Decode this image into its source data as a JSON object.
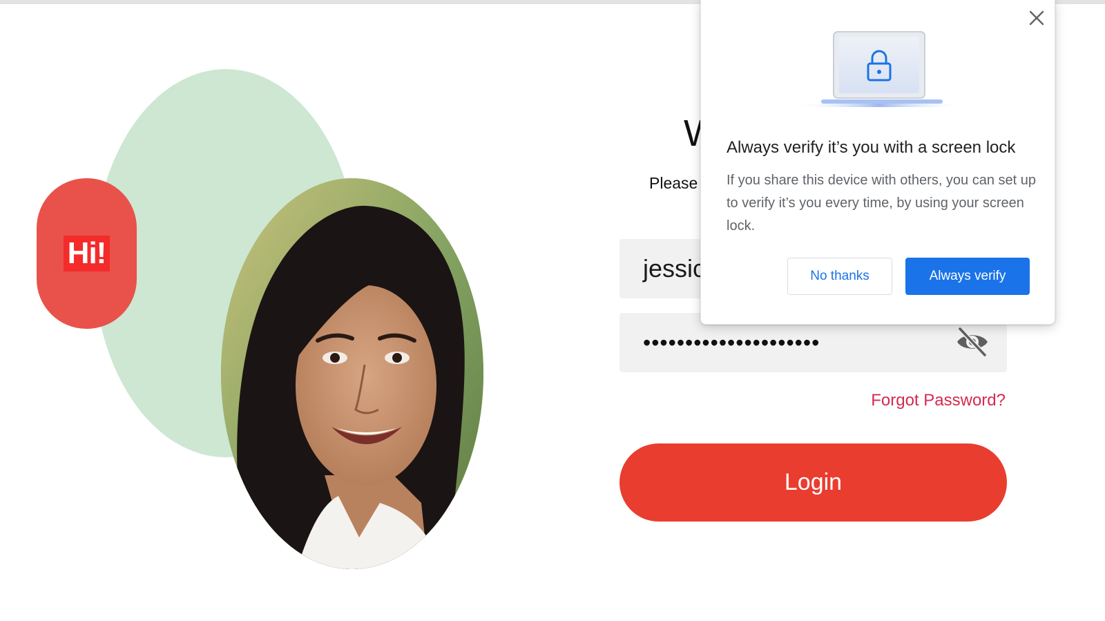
{
  "illustration": {
    "greeting_badge": "Hi!",
    "colors": {
      "green_blob": "#cde7d2",
      "hi_pill": "#e9524a",
      "hi_badge": "#f42b2b"
    }
  },
  "login_form": {
    "title_visible": "W",
    "subtitle_visible": "Please",
    "username_value_visible": "jessic",
    "password_masked": "•••••••••••••••••••••",
    "password_toggle_icon": "eye-slash-icon",
    "forgot_password_label": "Forgot Password?",
    "login_label": "Login",
    "colors": {
      "login_button": "#e93d2f",
      "forgot_link": "#d42a4f",
      "field_bg": "#f1f1f1"
    }
  },
  "verify_popup": {
    "close_icon": "close-icon",
    "hero_icon": "lock-icon",
    "title": "Always verify it’s you with a screen lock",
    "body": "If you share this device with others, you can set up to verify it’s you every time, by using your screen lock.",
    "secondary_label": "No thanks",
    "primary_label": "Always verify",
    "colors": {
      "accent": "#1a73e8",
      "body_text": "#5f6368"
    }
  }
}
